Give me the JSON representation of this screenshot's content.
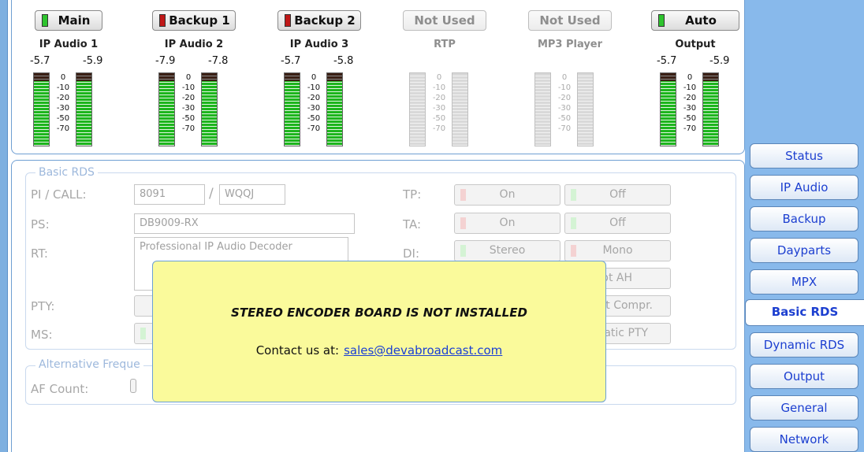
{
  "sources": [
    {
      "button": "Main",
      "lamp": "green",
      "name": "IP Audio 1",
      "left": "-5.7",
      "right": "-5.9",
      "active": true
    },
    {
      "button": "Backup 1",
      "lamp": "red",
      "name": "IP Audio 2",
      "left": "-7.9",
      "right": "-7.8",
      "active": true
    },
    {
      "button": "Backup 2",
      "lamp": "red",
      "name": "IP Audio 3",
      "left": "-5.7",
      "right": "-5.8",
      "active": true
    },
    {
      "button": "Not Used",
      "lamp": "none",
      "name": "RTP",
      "left": "",
      "right": "",
      "active": false
    },
    {
      "button": "Not Used",
      "lamp": "none",
      "name": "MP3 Player",
      "left": "",
      "right": "",
      "active": false
    },
    {
      "button": "Auto",
      "lamp": "green",
      "name": "Output",
      "left": "-5.7",
      "right": "-5.9",
      "active": true
    }
  ],
  "scale": [
    "0",
    "-10",
    "-20",
    "-30",
    "-50",
    "-70"
  ],
  "tabs": [
    "Status",
    "IP Audio",
    "Backup",
    "Dayparts",
    "MPX",
    "Basic RDS",
    "Dynamic RDS",
    "Output",
    "General",
    "Network"
  ],
  "active_tab": "Basic RDS",
  "basic_rds": {
    "group_label": "Basic RDS",
    "pi_label": "PI / CALL:",
    "pi_value": "8091",
    "call_value": "WQQJ",
    "separator": "/",
    "ps_label": "PS:",
    "ps_value": "DB9009-RX",
    "rt_label": "RT:",
    "rt_value": "Professional IP Audio Decoder",
    "pty_label": "PTY:",
    "ms_label": "MS:",
    "tp_label": "TP:",
    "tp_on": "On",
    "tp_off": "Off",
    "ta_label": "TA:",
    "ta_on": "On",
    "ta_off": "Off",
    "di_label": "DI:",
    "di_stereo": "Stereo",
    "di_mono": "Mono",
    "di_ah": "lot AH",
    "di_compr": "t Compr.",
    "di_pty": "atic PTY"
  },
  "af": {
    "group_label": "Alternative Freque",
    "count_label": "AF Count:"
  },
  "popup": {
    "message": "STEREO ENCODER BOARD IS NOT INSTALLED",
    "contact_label": "Contact us at:",
    "email": "sales@devabroadcast.com"
  },
  "colors": {
    "accent": "#1c3fd0",
    "panel": "#88b9eb",
    "popup": "#fafa9b"
  }
}
